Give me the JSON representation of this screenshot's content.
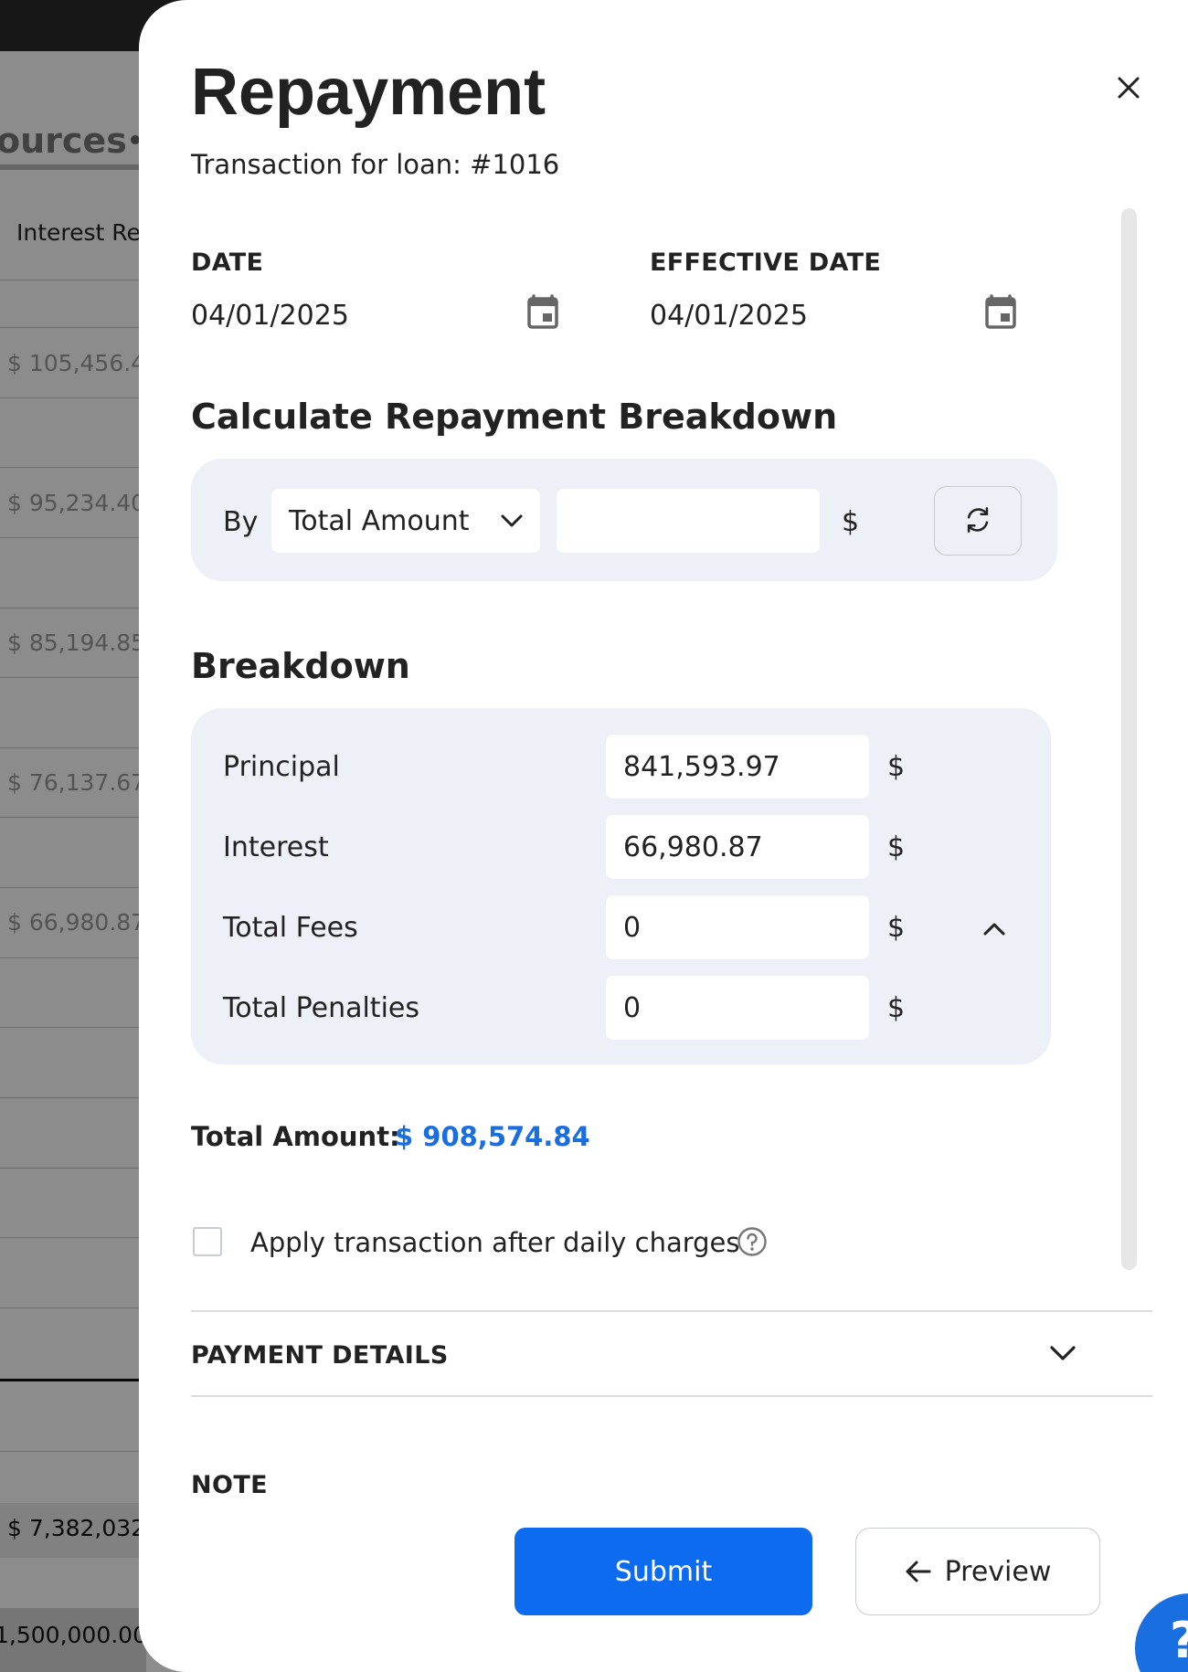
{
  "background": {
    "section_title": "ources",
    "column_header": "Interest Re",
    "rows": [
      "$ 105,456.4",
      "$ 95,234.40",
      "$ 85,194.85",
      "$ 76,137.67",
      "$ 66,980.87"
    ],
    "total": "$ 7,382,032",
    "footer_value": "1,500,000.00"
  },
  "drawer": {
    "title": "Repayment",
    "subtitle": "Transaction for loan: #1016",
    "date": {
      "label": "DATE",
      "value": "04/01/2025"
    },
    "effective_date": {
      "label": "EFFECTIVE DATE",
      "value": "04/01/2025"
    },
    "calculate": {
      "heading": "Calculate Repayment Breakdown",
      "by_label": "By",
      "by_selected": "Total Amount",
      "amount_value": "",
      "currency": "$"
    },
    "breakdown": {
      "heading": "Breakdown",
      "rows": [
        {
          "label": "Principal",
          "value": "841,593.97",
          "currency": "$"
        },
        {
          "label": "Interest",
          "value": "66,980.87",
          "currency": "$"
        },
        {
          "label": "Total Fees",
          "value": "0",
          "currency": "$"
        },
        {
          "label": "Total Penalties",
          "value": "0",
          "currency": "$"
        }
      ]
    },
    "total_amount_label": "Total Amount:",
    "total_amount_value": "$ 908,574.84",
    "apply_after_daily_label": "Apply transaction after daily charges",
    "payment_details_label": "PAYMENT DETAILS",
    "note_label": "NOTE",
    "submit_label": "Submit",
    "preview_label": "Preview",
    "help_fab_label": "?"
  },
  "colors": {
    "accent": "#0d6bf0",
    "total_value": "#1a6fe0",
    "panel_bg": "#edf0f6"
  },
  "icons": [
    "close-icon",
    "calendar-icon",
    "chevron-down-icon",
    "refresh-icon",
    "chevron-up-icon",
    "help-circle-icon",
    "arrow-left-icon"
  ]
}
